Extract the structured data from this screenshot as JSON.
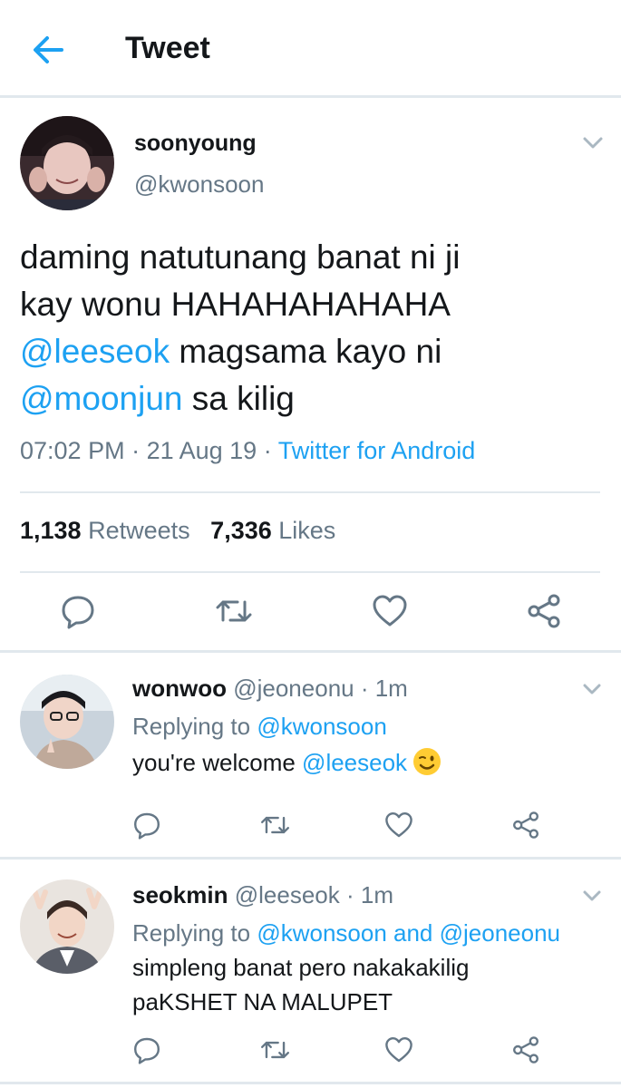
{
  "header": {
    "title": "Tweet",
    "back_icon": "arrow-left-icon",
    "accent": "#1da1f2"
  },
  "tweet": {
    "name": "soonyoung",
    "handle": "@kwonsoon",
    "text_line1": "daming natutunang banat ni ji",
    "text_line2": "kay wonu HAHAHAHAHAHA",
    "mention1": "@leeseok",
    "text_line3_rest": " magsama kayo ni",
    "mention2": "@moonjun",
    "text_line4_rest": " sa kilig",
    "time": "07:02 PM",
    "sep1": " · ",
    "date": "21 Aug 19",
    "sep2": " · ",
    "source": "Twitter for Android",
    "retweets_count": "1,138",
    "retweets_label": "Retweets",
    "likes_count": "7,336",
    "likes_label": "Likes"
  },
  "replies": [
    {
      "name": "wonwoo",
      "handle": "@jeoneonu",
      "time": "1m",
      "replying_prefix": "Replying to ",
      "replying_to": "@kwonsoon",
      "text": "you're welcome ",
      "mention": "@leeseok",
      "emoji": "winking-face-icon"
    },
    {
      "name": "seokmin",
      "handle": "@leeseok",
      "time": "1m",
      "replying_prefix": "Replying to ",
      "replying_to": "@kwonsoon and @jeoneonu",
      "text_line1": "simpleng banat pero nakakakilig",
      "text_line2": "paKSHET NA MALUPET"
    }
  ],
  "icons": [
    "reply-icon",
    "retweet-icon",
    "like-icon",
    "share-icon",
    "chevron-down-icon"
  ]
}
